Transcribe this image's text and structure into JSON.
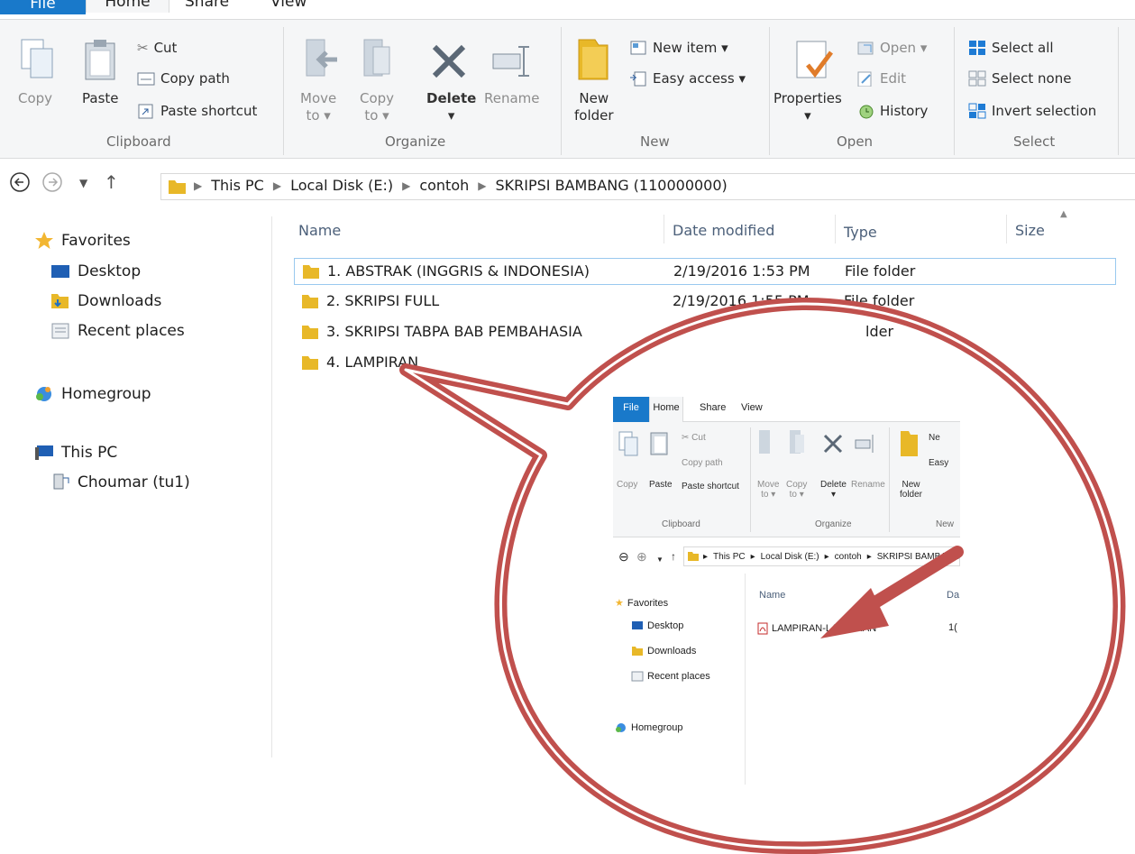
{
  "main": {
    "tabs": [
      "File",
      "Home",
      "Share",
      "View"
    ],
    "ribbon": {
      "clipboard": {
        "copy": "Copy",
        "paste": "Paste",
        "cut": "Cut",
        "copy_path": "Copy path",
        "paste_shortcut": "Paste shortcut",
        "group": "Clipboard"
      },
      "organize": {
        "move_to": "Move",
        "move_to2": "to ▾",
        "copy_to": "Copy",
        "copy_to2": "to ▾",
        "delete": "Delete",
        "delete2": "▾",
        "rename": "Rename",
        "group": "Organize"
      },
      "new": {
        "new_folder": "New",
        "new_folder2": "folder",
        "new_item": "New item ▾",
        "easy_access": "Easy access ▾",
        "group": "New"
      },
      "open": {
        "properties": "Properties",
        "properties2": "▾",
        "open": "Open ▾",
        "edit": "Edit",
        "history": "History",
        "group": "Open"
      },
      "select": {
        "select_all": "Select all",
        "select_none": "Select none",
        "invert": "Invert selection",
        "group": "Select"
      }
    },
    "breadcrumb": [
      "This PC",
      "Local Disk (E:)",
      "contoh",
      "SKRIPSI BAMBANG (110000000)"
    ],
    "nav": {
      "favorites": "Favorites",
      "desktop": "Desktop",
      "downloads": "Downloads",
      "recent": "Recent places",
      "homegroup": "Homegroup",
      "this_pc": "This PC",
      "network": "Choumar (tu1)"
    },
    "columns": {
      "name": "Name",
      "date": "Date modified",
      "type": "Type",
      "size": "Size"
    },
    "files": [
      {
        "name": "1. ABSTRAK (INGGRIS & INDONESIA)",
        "date": "2/19/2016 1:53 PM",
        "type": "File folder"
      },
      {
        "name": "2. SKRIPSI FULL",
        "date": "2/19/2016 1:55 PM",
        "type": "File folder"
      },
      {
        "name": "3. SKRIPSI TABPA BAB PEMBAHASIA",
        "date": "",
        "type": "lder"
      },
      {
        "name": "4. LAMPIRAN",
        "date": "",
        "type": ""
      }
    ]
  },
  "inset": {
    "tabs": [
      "File",
      "Home",
      "Share",
      "View"
    ],
    "ribbon": {
      "copy": "Copy",
      "paste": "Paste",
      "cut": "Cut",
      "copy_path": "Copy path",
      "paste_shortcut": "Paste shortcut",
      "clipboard": "Clipboard",
      "move": "Move",
      "move2": "to ▾",
      "copy_to": "Copy",
      "copy_to2": "to ▾",
      "delete": "Delete",
      "delete2": "▾",
      "rename": "Rename",
      "organize": "Organize",
      "new_folder": "New",
      "new_folder2": "folder",
      "new_item": "Ne",
      "easy": "Easy",
      "new_group": "New"
    },
    "breadcrumb": [
      "This PC",
      "Local Disk (E:)",
      "contoh",
      "SKRIPSI BAMBANG ("
    ],
    "nav": {
      "favorites": "Favorites",
      "desktop": "Desktop",
      "downloads": "Downloads",
      "recent": "Recent places",
      "homegroup": "Homegroup"
    },
    "columns": {
      "name": "Name",
      "date": "Da"
    },
    "files": [
      {
        "name": "LAMPIRAN-LAMPIRAN",
        "date": "1("
      }
    ]
  },
  "colors": {
    "accent": "#1979ca",
    "folder": "#e8b828",
    "callout": "#c0504d",
    "selection_border": "#99c9ef"
  }
}
